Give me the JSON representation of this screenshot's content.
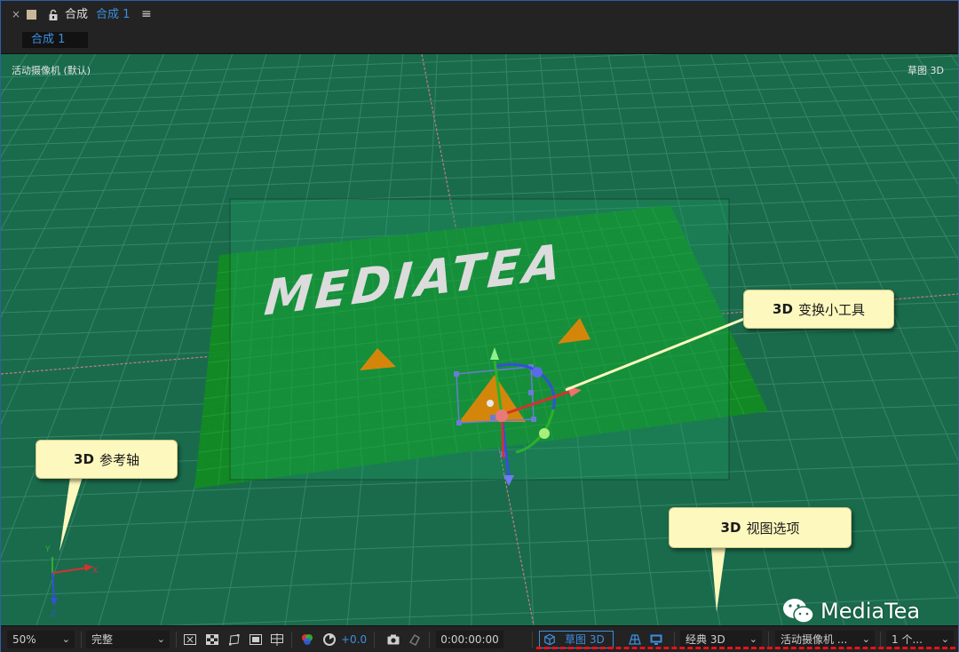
{
  "panel": {
    "close_label": "×",
    "title": "合成",
    "comp_name": "合成 1",
    "menu_label": "≡",
    "tab_label": "合成 1"
  },
  "viewer": {
    "camera_label": "活动摄像机 (默认)",
    "renderer_label": "草图 3D",
    "composition_text": "MEDIATEA",
    "axis_labels": {
      "x": "X",
      "y": "Y",
      "z": "Z"
    }
  },
  "callouts": {
    "gizmo": {
      "bold": "3D",
      "text": "变换小工具"
    },
    "axis": {
      "bold": "3D",
      "text": "参考轴"
    },
    "view": {
      "bold": "3D",
      "text": "视图选项"
    }
  },
  "watermark": {
    "text": "MediaTea",
    "icon": "wechat-icon"
  },
  "toolbar": {
    "zoom": "50%",
    "resolution": "完整",
    "exposure": "+0.0",
    "timecode": "0:00:00:00",
    "draft3d": "草图 3D",
    "renderer": "经典 3D",
    "camera": "活动摄像机 ...",
    "views": "1 个...",
    "icons": [
      "region-icon",
      "transparency-grid-icon",
      "mask-path-icon",
      "safe-zones-icon",
      "grid-guides-icon",
      "color-channel-icon",
      "reset-exposure-icon",
      "snapshot-icon",
      "show-snapshot-icon",
      "draft3d-cube-icon",
      "ground-plane-icon",
      "extended-viewer-icon"
    ]
  },
  "colors": {
    "accent_blue": "#3b8fe0",
    "viewer_green": "#1a6b4c",
    "layer_green": "#118c22",
    "callout_fill": "#fdf8bd",
    "highlight_red": "#e0141c"
  }
}
